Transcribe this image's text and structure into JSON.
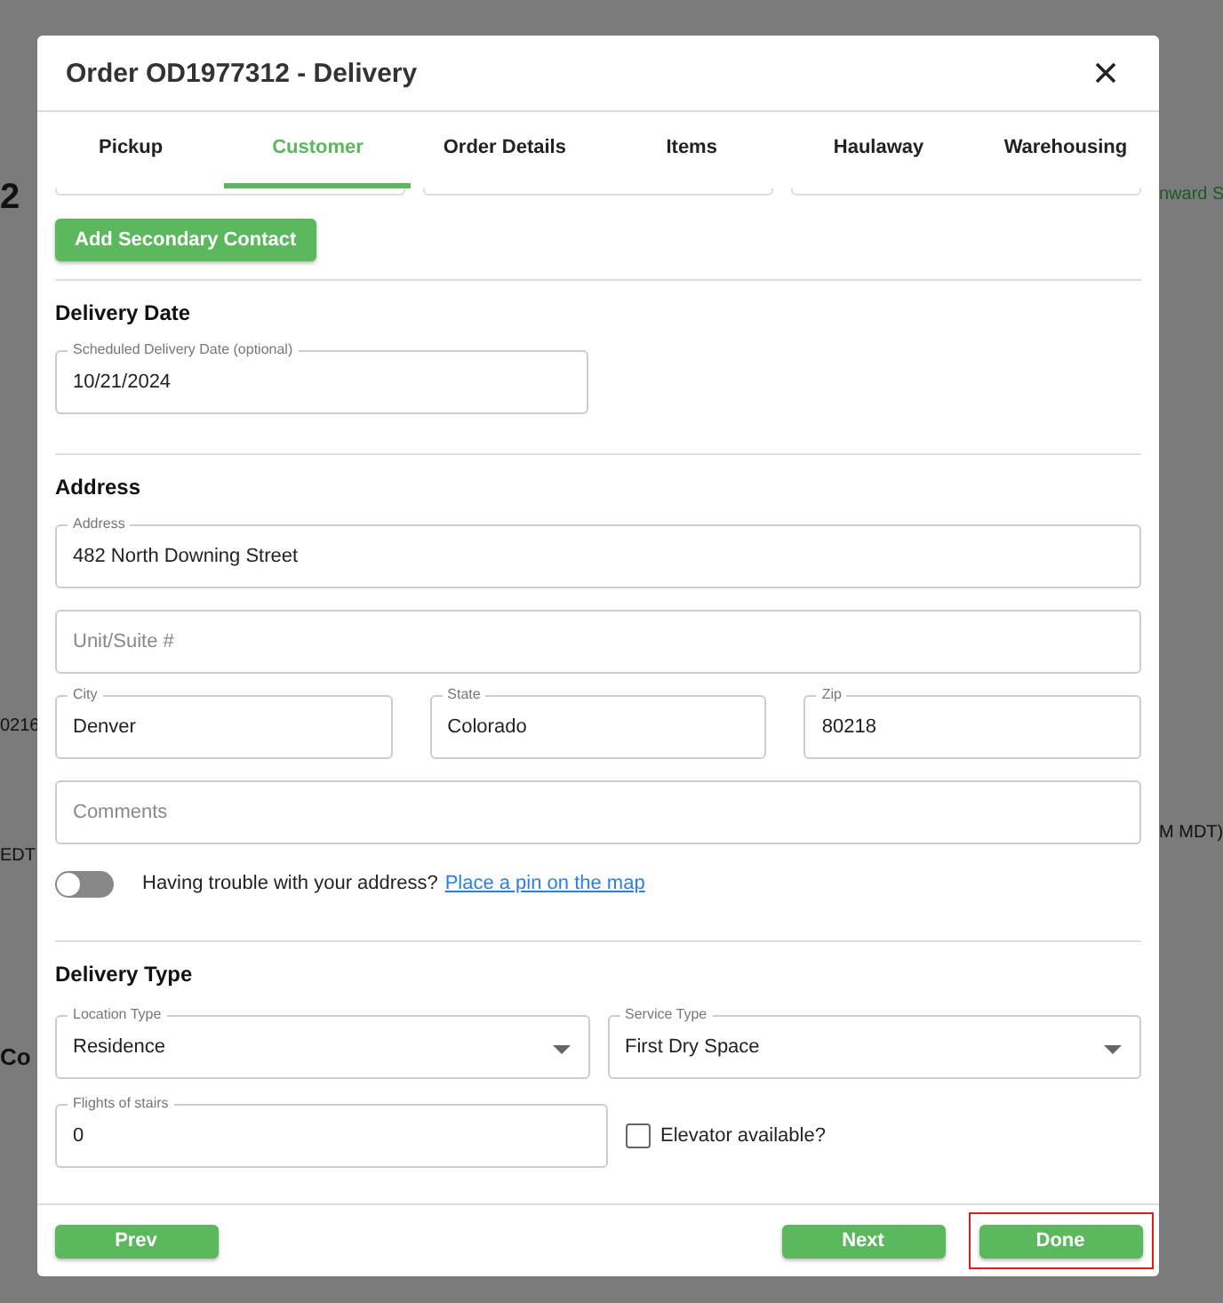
{
  "background_page": {
    "left_texts": [
      {
        "text": "2",
        "kind": "heading"
      },
      {
        "text": "0216",
        "kind": "plain"
      },
      {
        "text": "EDT",
        "kind": "plain"
      },
      {
        "text": "Co",
        "kind": "heading"
      }
    ],
    "right_texts": [
      {
        "text": "nward S",
        "kind": "link"
      },
      {
        "text": "M MDT)",
        "kind": "plain"
      }
    ]
  },
  "dialog": {
    "title": "Order OD1977312 - Delivery",
    "tabs": [
      {
        "label": "Pickup",
        "selected": false
      },
      {
        "label": "Customer",
        "selected": true
      },
      {
        "label": "Order Details",
        "selected": false
      },
      {
        "label": "Items",
        "selected": false
      },
      {
        "label": "Haulaway",
        "selected": false
      },
      {
        "label": "Warehousing",
        "selected": false
      }
    ],
    "contact": {
      "button": "Add Secondary Contact"
    },
    "delivery_date": {
      "heading": "Delivery Date",
      "field": {
        "kind": "text",
        "label": "Scheduled Delivery Date (optional)",
        "value": "10/21/2024"
      }
    },
    "address": {
      "heading": "Address",
      "rows": [
        [
          {
            "kind": "text",
            "label": "Address",
            "value": "482 North Downing Street"
          }
        ],
        [
          {
            "kind": "text",
            "placeholder": "Unit/Suite #"
          }
        ],
        [
          {
            "kind": "text",
            "label": "City",
            "value": "Denver"
          },
          {
            "kind": "text",
            "label": "State",
            "value": "Colorado"
          },
          {
            "kind": "text",
            "label": "Zip",
            "value": "80218"
          }
        ],
        [
          {
            "kind": "text",
            "placeholder": "Comments"
          }
        ]
      ],
      "map_toggle": {
        "on": false,
        "text": "Having trouble with your address?",
        "link": "Place a pin on the map"
      }
    },
    "delivery_type": {
      "heading": "Delivery Type",
      "rows": [
        [
          {
            "kind": "select",
            "label": "Location Type",
            "value": "Residence"
          },
          {
            "kind": "select",
            "label": "Service Type",
            "value": "First Dry Space"
          }
        ],
        [
          {
            "kind": "text",
            "label": "Flights of stairs",
            "value": "0"
          },
          {
            "kind": "checkbox",
            "label": "Elevator available?",
            "checked": false
          }
        ]
      ]
    },
    "footer": {
      "left_buttons": [
        {
          "label": "Prev",
          "highlighted": false
        }
      ],
      "right_buttons": [
        {
          "label": "Next",
          "highlighted": false
        },
        {
          "label": "Done",
          "highlighted": true
        }
      ]
    }
  }
}
